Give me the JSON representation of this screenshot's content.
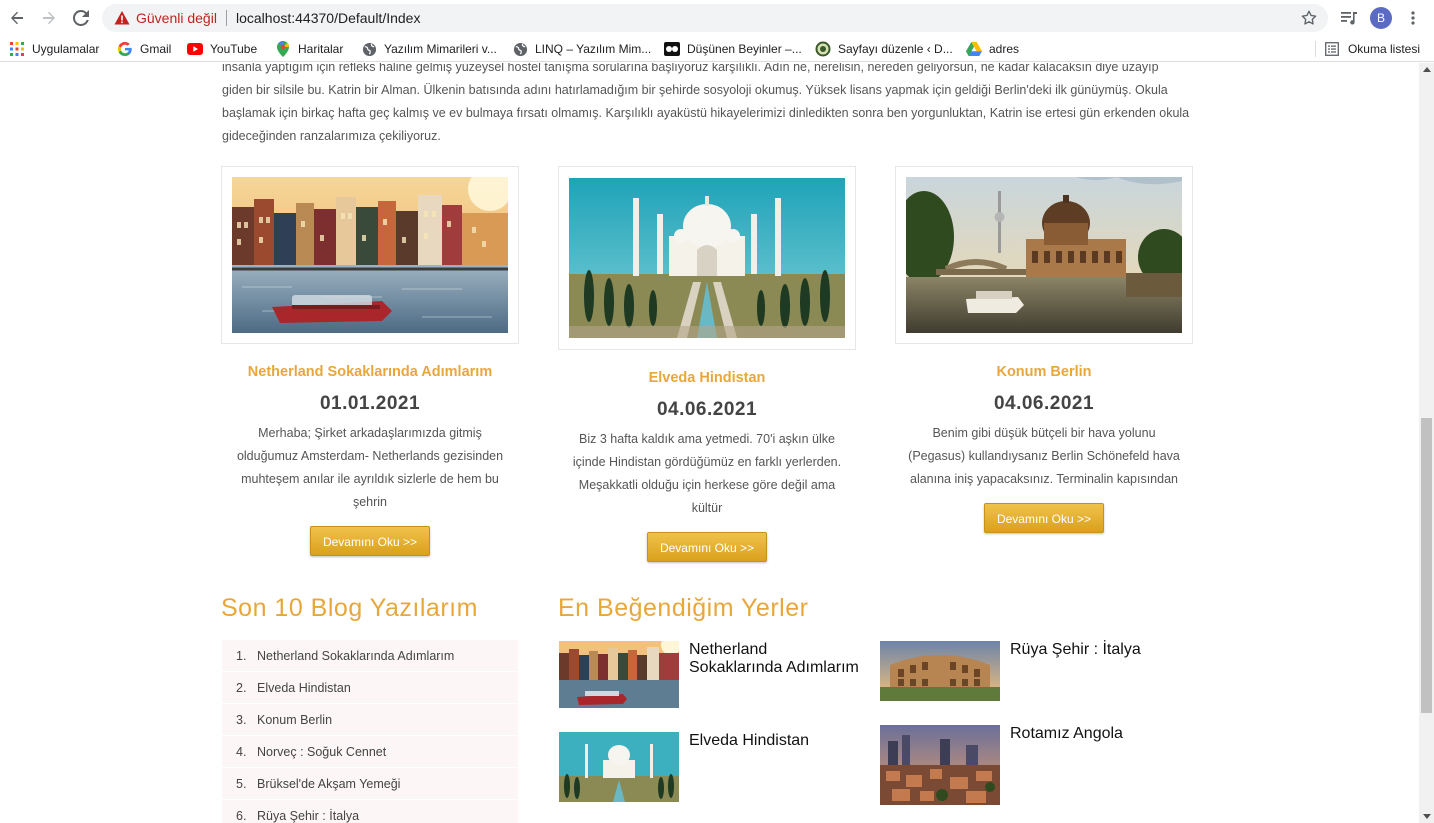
{
  "browser": {
    "security_label": "Güvenli değil",
    "url": "localhost:44370/Default/Index",
    "profile_initial": "B",
    "bookmarks": [
      {
        "label": "Uygulamalar",
        "icon": "apps-grid-icon"
      },
      {
        "label": "Gmail",
        "icon": "google-icon"
      },
      {
        "label": "YouTube",
        "icon": "youtube-icon"
      },
      {
        "label": "Haritalar",
        "icon": "maps-pin-icon"
      },
      {
        "label": "Yazılım Mimarileri v...",
        "icon": "globe-icon"
      },
      {
        "label": "LINQ – Yazılım Mim...",
        "icon": "globe-icon"
      },
      {
        "label": "Düşünen Beyinler –...",
        "icon": "site-icon"
      },
      {
        "label": "Sayfayı düzenle ‹ D...",
        "icon": "wordpress-icon"
      },
      {
        "label": "adres",
        "icon": "drive-icon"
      }
    ],
    "reading_list": "Okuma listesi"
  },
  "page": {
    "intro": "insanla yaptığım için refleks haline gelmiş yüzeysel hostel tanışma sorularına başlıyoruz karşılıklı. Adın ne, nerelisin, nereden geliyorsun, ne kadar kalacaksın diye uzayıp giden bir silsile bu. Katrin bir Alman. Ülkenin batısında adını hatırlamadığım bir şehirde sosyoloji okumuş. Yüksek lisans yapmak için geldiği Berlin'deki ilk günüymüş. Okula başlamak için birkaç hafta geç kalmış ve ev bulmaya fırsatı olmamış. Karşılıklı ayaküstü hikayelerimizi dinledikten sonra ben yorgunluktan, Katrin ise ertesi gün erkenden okula gideceğinden ranzalarımıza çekiliyoruz.",
    "cards": [
      {
        "title": "Netherland Sokaklarında Adımlarım",
        "date": "01.01.2021",
        "text": "Merhaba; Şirket arkadaşlarımızda gitmiş olduğumuz Amsterdam- Netherlands gezisinden muhteşem anılar ile ayrıldık sizlerle de hem bu şehrin",
        "button": "Devamını Oku >>"
      },
      {
        "title": "Elveda Hindistan",
        "date": "04.06.2021",
        "text": "Biz 3 hafta kaldık ama yetmedi. 70'i aşkın ülke içinde Hindistan gördüğümüz en farklı yerlerden. Meşakkatli olduğu için herkese göre değil ama kültür",
        "button": "Devamını Oku >>"
      },
      {
        "title": "Konum Berlin",
        "date": "04.06.2021",
        "text": "Benim gibi düşük bütçeli bir hava yolunu (Pegasus) kullandıysanız Berlin Schönefeld hava alanına iniş yapacaksınız. Terminalin kapısından",
        "button": "Devamını Oku >>"
      }
    ],
    "blog_section_title": "Son 10 Blog Yazılarım",
    "blog_list": [
      {
        "num": "1.",
        "label": "Netherland Sokaklarında Adımlarım"
      },
      {
        "num": "2.",
        "label": "Elveda Hindistan"
      },
      {
        "num": "3.",
        "label": "Konum Berlin"
      },
      {
        "num": "4.",
        "label": "Norveç : Soğuk Cennet"
      },
      {
        "num": "5.",
        "label": "Brüksel'de Akşam Yemeği"
      },
      {
        "num": "6.",
        "label": "Rüya Şehir : İtalya"
      }
    ],
    "favorites_title": "En Beğendiğim Yerler",
    "favorites": [
      {
        "label": "Netherland Sokaklarında Adımlarım"
      },
      {
        "label": "Rüya Şehir : İtalya"
      },
      {
        "label": "Elveda Hindistan"
      },
      {
        "label": "Rotamız Angola"
      }
    ]
  }
}
